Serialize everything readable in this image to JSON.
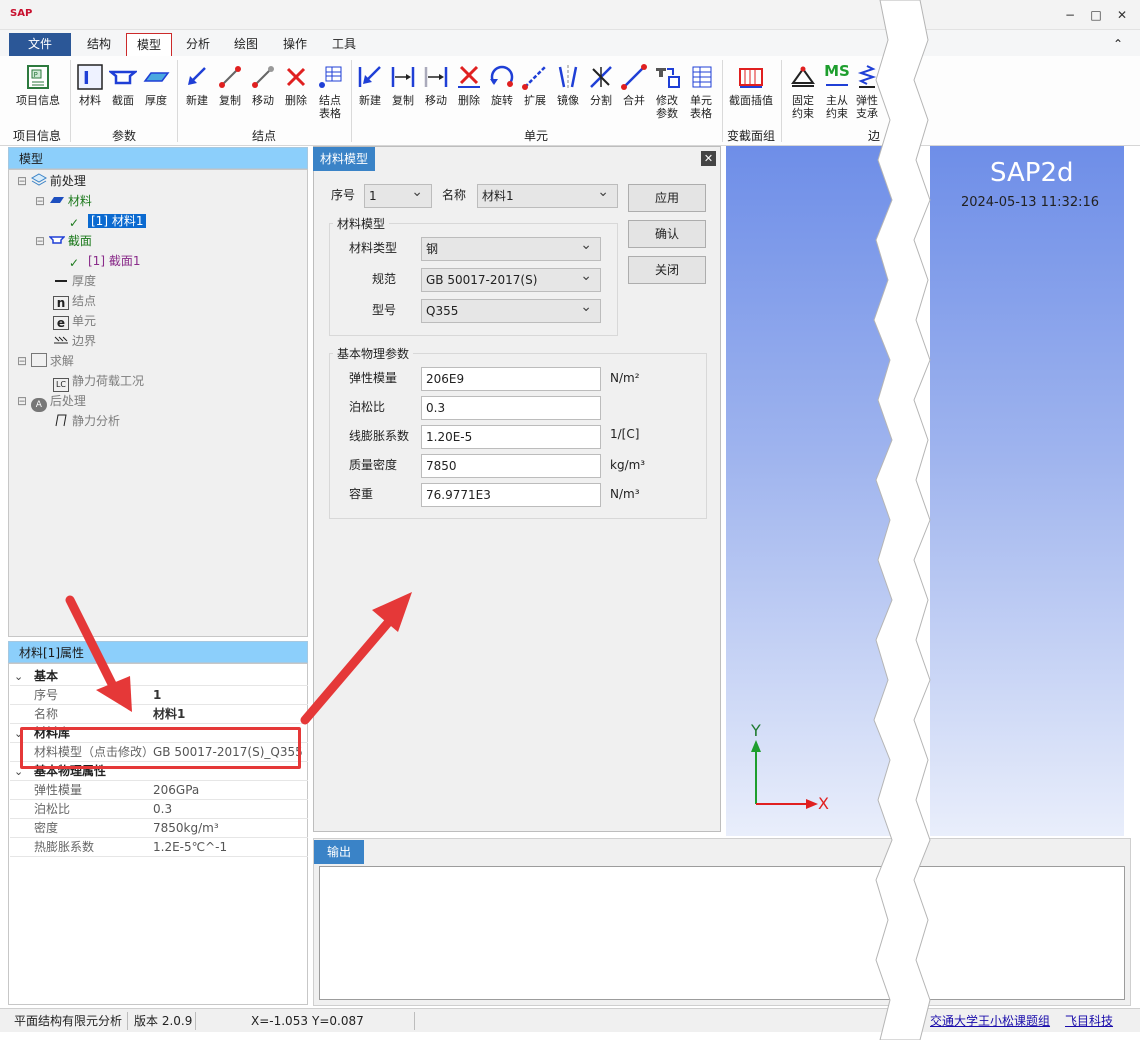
{
  "app": {
    "logo": "SAP",
    "win_min": "−",
    "win_max": "□",
    "win_close": "✕",
    "collapse": "⌃"
  },
  "menu": [
    {
      "label": "文件"
    },
    {
      "label": "结构"
    },
    {
      "label": "模型"
    },
    {
      "label": "分析"
    },
    {
      "label": "绘图"
    },
    {
      "label": "操作"
    },
    {
      "label": "工具"
    }
  ],
  "ribbon": {
    "buttons": [
      {
        "label": "项目信息",
        "icon": "project-info-icon"
      },
      {
        "label": "材料",
        "icon": "material-icon"
      },
      {
        "label": "截面",
        "icon": "section-icon"
      },
      {
        "label": "厚度",
        "icon": "thickness-icon"
      },
      {
        "label": "新建",
        "icon": "node-new-icon"
      },
      {
        "label": "复制",
        "icon": "node-copy-icon"
      },
      {
        "label": "移动",
        "icon": "node-move-icon"
      },
      {
        "label": "删除",
        "icon": "node-delete-icon"
      },
      {
        "label": "结点\n表格",
        "icon": "node-table-icon"
      },
      {
        "label": "新建",
        "icon": "element-new-icon"
      },
      {
        "label": "复制",
        "icon": "element-copy-icon"
      },
      {
        "label": "移动",
        "icon": "element-move-icon"
      },
      {
        "label": "删除",
        "icon": "element-delete-icon"
      },
      {
        "label": "旋转",
        "icon": "element-rotate-icon"
      },
      {
        "label": "扩展",
        "icon": "element-extend-icon"
      },
      {
        "label": "镜像",
        "icon": "element-mirror-icon"
      },
      {
        "label": "分割",
        "icon": "element-split-icon"
      },
      {
        "label": "合并",
        "icon": "element-merge-icon"
      },
      {
        "label": "修改\n参数",
        "icon": "element-modify-icon"
      },
      {
        "label": "单元\n表格",
        "icon": "element-table-icon"
      },
      {
        "label": "截面插值",
        "icon": "section-interp-icon"
      },
      {
        "label": "固定\n约束",
        "icon": "fixed-support-icon"
      },
      {
        "label": "主从\n约束",
        "icon": "master-slave-icon"
      },
      {
        "label": "弹性\n支承",
        "icon": "spring-support-icon"
      }
    ],
    "groups": [
      "项目信息",
      "参数",
      "结点",
      "单元",
      "变截面组",
      "边"
    ],
    "ms_text": "MS"
  },
  "model_panel": {
    "title": "模型",
    "tree": [
      {
        "label": "前处理",
        "style": "normal"
      },
      {
        "label": "材料",
        "style": "green"
      },
      {
        "label": "[1] 材料1",
        "style": "selected"
      },
      {
        "label": "截面",
        "style": "green"
      },
      {
        "label": "[1] 截面1",
        "style": "purple"
      },
      {
        "label": "厚度",
        "style": "dim"
      },
      {
        "label": "结点",
        "style": "dim"
      },
      {
        "label": "单元",
        "style": "dim"
      },
      {
        "label": "边界",
        "style": "dim"
      },
      {
        "label": "求解",
        "style": "dim"
      },
      {
        "label": "静力荷载工况",
        "style": "dim"
      },
      {
        "label": "后处理",
        "style": "dim"
      },
      {
        "label": "静力分析",
        "style": "dim"
      }
    ],
    "icon_letters": {
      "node": "n",
      "element": "e",
      "lc": "LC",
      "post": "A"
    }
  },
  "props_panel": {
    "title": "材料[1]属性",
    "rows": [
      {
        "key": "基本",
        "value": "",
        "section": true
      },
      {
        "key": "序号",
        "value": "1",
        "bold": true
      },
      {
        "key": "名称",
        "value": "材料1",
        "bold": true
      },
      {
        "key": "材料库",
        "value": "",
        "section": true
      },
      {
        "key": "材料模型（点击修改）",
        "value": "GB 50017-2017(S)_Q355"
      },
      {
        "key": "基本物理属性",
        "value": "",
        "section": true
      },
      {
        "key": "弹性模量",
        "value": "206GPa"
      },
      {
        "key": "泊松比",
        "value": "0.3"
      },
      {
        "key": "密度",
        "value": "7850kg/m³"
      },
      {
        "key": "热膨胀系数",
        "value": "1.2E-5℃^-1"
      }
    ]
  },
  "dialog": {
    "tab": "材料模型",
    "close": "✕",
    "index_label": "序号",
    "index_value": "1",
    "name_label": "名称",
    "name_value": "材料1",
    "buttons": {
      "apply": "应用",
      "ok": "确认",
      "close": "关闭"
    },
    "model_group": {
      "title": "材料模型",
      "rows": [
        {
          "label": "材料类型",
          "value": "钢"
        },
        {
          "label": "规范",
          "value": "GB 50017-2017(S)"
        },
        {
          "label": "型号",
          "value": "Q355"
        }
      ]
    },
    "phys_group": {
      "title": "基本物理参数",
      "rows": [
        {
          "label": "弹性模量",
          "value": "206E9",
          "unit": "N/m²"
        },
        {
          "label": "泊松比",
          "value": "0.3",
          "unit": ""
        },
        {
          "label": "线膨胀系数",
          "value": "1.20E-5",
          "unit": "1/[C]"
        },
        {
          "label": "质量密度",
          "value": "7850",
          "unit": "kg/m³"
        },
        {
          "label": "容重",
          "value": "76.9771E3",
          "unit": "N/m³"
        }
      ]
    }
  },
  "viewport": {
    "title": "SAP2d",
    "timestamp": "2024-05-13 11:32:16",
    "axis_x": "X",
    "axis_y": "Y"
  },
  "output": {
    "tab": "输出"
  },
  "status": {
    "app_name": "平面结构有限元分析",
    "version": "版本 2.0.9",
    "coord_x": "X=-1.053",
    "coord_y": "Y=0.087",
    "credit": "交通大学王小松课题组",
    "company": "飞目科技"
  },
  "colors": {
    "accent": "#2b5797",
    "panel_head": "#8ccffb",
    "tab_blue": "#3a83c7",
    "annotation": "#e53838",
    "icon_blue": "#1f3fd6",
    "icon_red": "#e02020"
  }
}
